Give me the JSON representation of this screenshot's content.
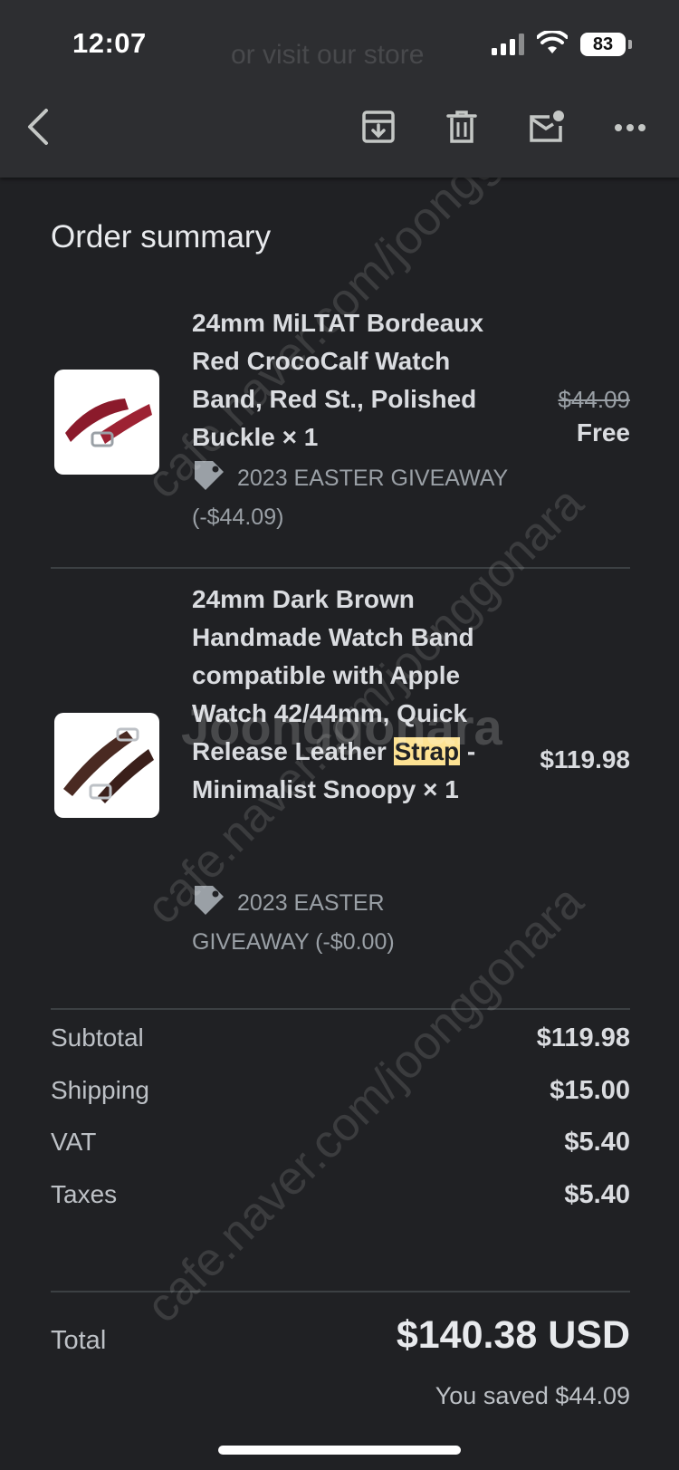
{
  "status_bar": {
    "time": "12:07",
    "battery": "83",
    "ghost_text": "or visit our store"
  },
  "toolbar": {
    "back_icon": "chevron-left-icon",
    "archive_icon": "archive-icon",
    "delete_icon": "trash-icon",
    "unread_icon": "mark-unread-icon",
    "more_icon": "more-horiz-icon"
  },
  "order": {
    "title": "Order summary",
    "items": [
      {
        "name": "24mm MiLTAT Bordeaux Red CrocoCalf Watch Band, Red St., Polished Buckle × 1",
        "original_price": "$44.09",
        "price": "Free",
        "discount": "2023 EASTER GIVEAWAY (-$44.09)",
        "thumb_color": "#8b1a2b"
      },
      {
        "name_before": "24mm Dark Brown Handmade Watch Band compatible with Apple Watch 42/44mm, Quick Release Leather ",
        "name_highlight": "Strap",
        "name_after": " - Minimalist Snoopy × 1",
        "price": "$119.98",
        "discount": "2023 EASTER GIVEAWAY (-$0.00)",
        "thumb_color": "#4a2a22"
      }
    ],
    "summary": [
      {
        "label": "Subtotal",
        "value": "$119.98"
      },
      {
        "label": "Shipping",
        "value": "$15.00"
      },
      {
        "label": "VAT",
        "value": "$5.40"
      },
      {
        "label": "Taxes",
        "value": "$5.40"
      }
    ],
    "total_label": "Total",
    "total_value": "$140.38 USD",
    "saved_label": "You saved",
    "saved_value": "$44.09"
  },
  "watermarks": [
    "cafe.naver.com/joonggonara",
    "cafe.naver.com/joonggonara",
    "cafe.naver.com/joonggonara",
    "Joonggonara"
  ],
  "colors": {
    "background": "#202124",
    "header": "#2d2e31",
    "highlight": "#fde293"
  }
}
